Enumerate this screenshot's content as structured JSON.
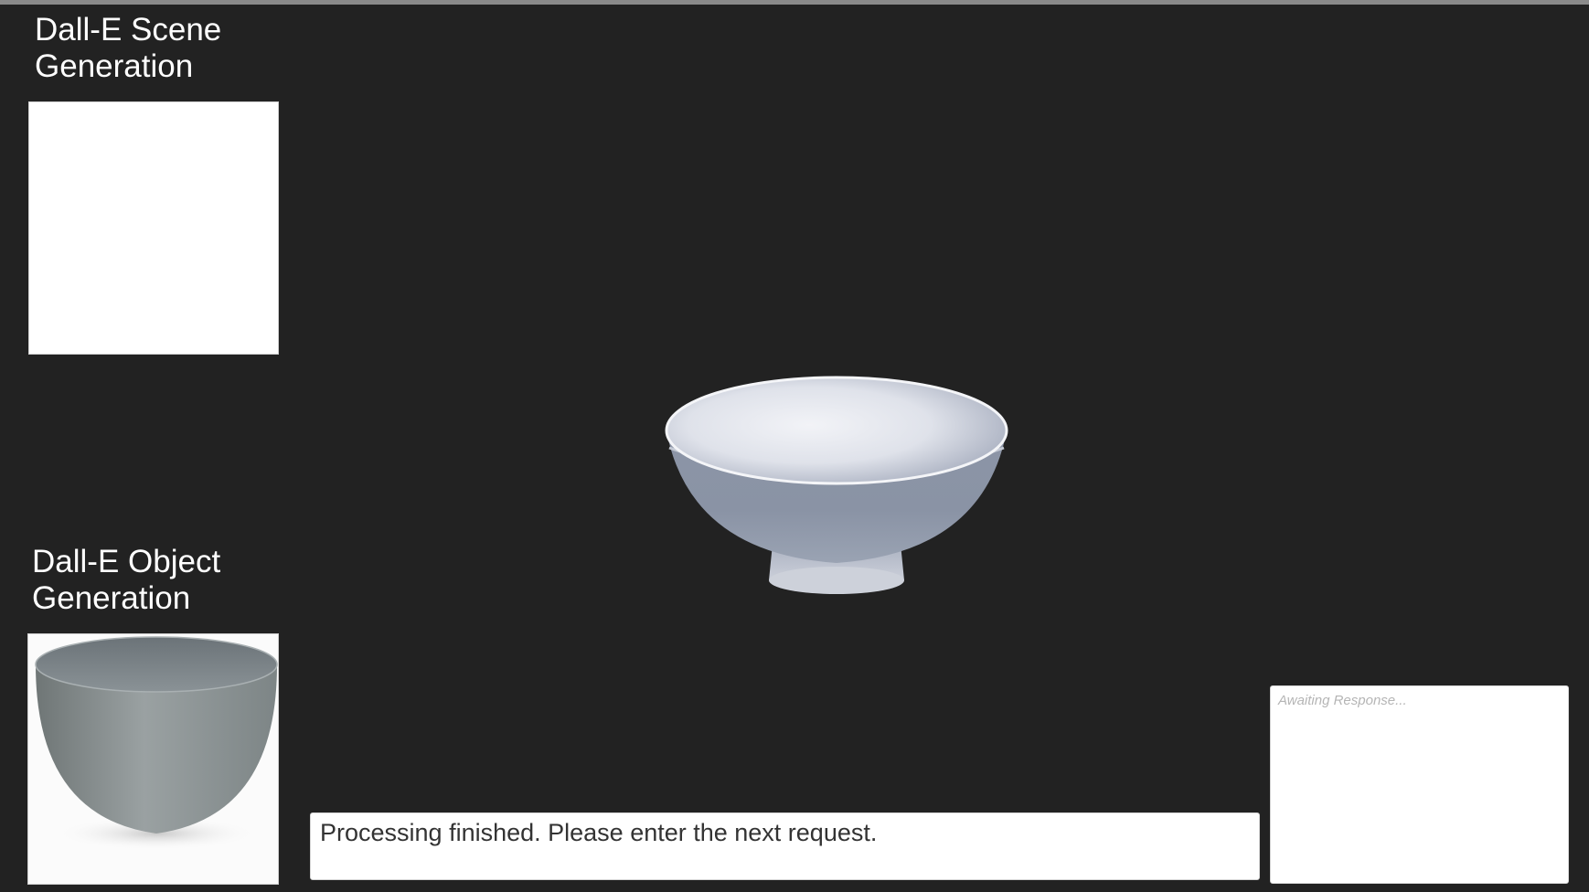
{
  "scene_panel": {
    "title": "Dall-E Scene Generation"
  },
  "object_panel": {
    "title": "Dall-E Object Generation",
    "image": "bowl-render"
  },
  "viewport": {
    "object": "3d-bowl-model"
  },
  "status": {
    "message": "Processing finished. Please enter the next request."
  },
  "response": {
    "placeholder": "Awaiting Response..."
  },
  "colors": {
    "background": "#222222",
    "panel": "#ffffff",
    "title_text": "#ffffff"
  }
}
